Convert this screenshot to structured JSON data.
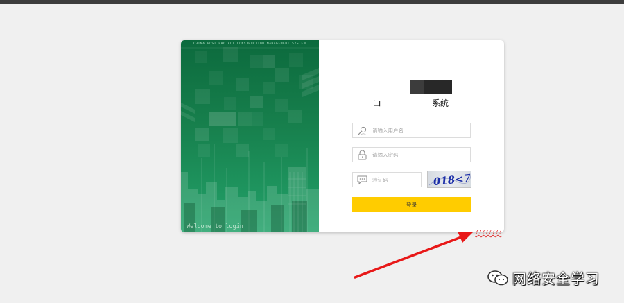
{
  "panel": {
    "system_name_en": "CHINA POST PROJECT CONSTRUCTION MANAGEMENT SYSTEM",
    "welcome": "Welcome to login"
  },
  "form": {
    "title_left": "コ",
    "title_right": "系统",
    "username": {
      "placeholder": "请输入用户名",
      "value": "",
      "icon": "user-icon"
    },
    "password": {
      "placeholder": "请输入密码",
      "value": "",
      "icon": "lock-icon"
    },
    "captcha": {
      "placeholder": "验证码",
      "value": "",
      "icon": "chat-icon",
      "image_text": "018<7"
    },
    "login_label": "登录"
  },
  "annotation": {
    "forgot_text": "????????",
    "arrow_color": "#e81818"
  },
  "watermark": {
    "icon": "wechat-icon",
    "text": "网络安全学习"
  },
  "colors": {
    "panel_green": "#17804d",
    "button_yellow": "#ffcc00",
    "page_bg": "#f0f0f0"
  }
}
